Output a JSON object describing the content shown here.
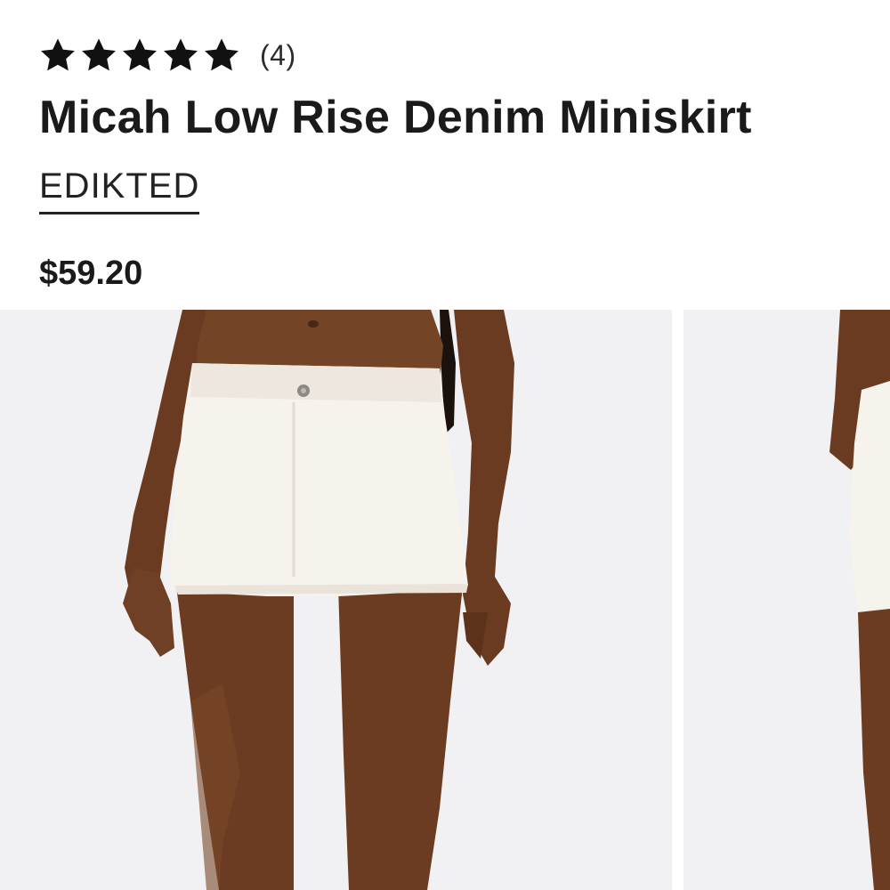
{
  "product": {
    "rating": {
      "stars": 5,
      "max_stars": 5,
      "review_count": "(4)"
    },
    "title": "Micah Low Rise Denim Miniskirt",
    "brand": "EDIKTED",
    "price": "$59.20"
  },
  "gallery": {
    "images": [
      {
        "name": "product-photo-front"
      },
      {
        "name": "product-photo-side"
      }
    ]
  },
  "icons": {
    "star": "star-icon"
  },
  "colors": {
    "text": "#1a1a1a",
    "photo_background": "#f1f0f2",
    "skirt": "#f6f2ec",
    "skin": "#6b3d22"
  }
}
